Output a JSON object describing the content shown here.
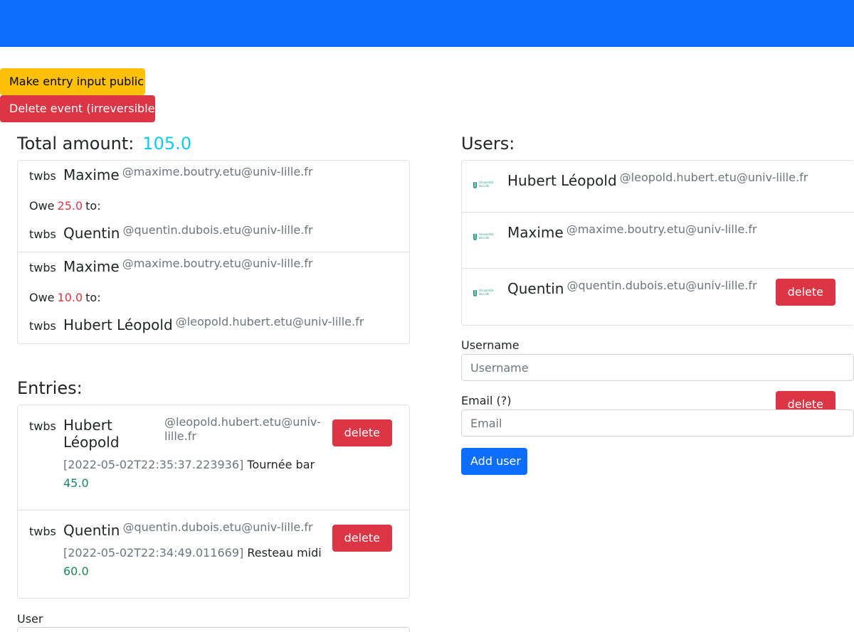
{
  "actions": {
    "make_public": "Make entry input public",
    "delete_event": "Delete event (irreversible)"
  },
  "total": {
    "label": "Total amount:",
    "value": "105.0"
  },
  "debts": [
    {
      "from": {
        "avatar": "twbs",
        "name": "Maxime",
        "email": "@maxime.boutry.etu@univ-lille.fr"
      },
      "owe_prefix": "Owe",
      "amount": "25.0",
      "owe_suffix": "to:",
      "to": {
        "avatar": "twbs",
        "name": "Quentin",
        "email": "@quentin.dubois.etu@univ-lille.fr"
      }
    },
    {
      "from": {
        "avatar": "twbs",
        "name": "Maxime",
        "email": "@maxime.boutry.etu@univ-lille.fr"
      },
      "owe_prefix": "Owe",
      "amount": "10.0",
      "owe_suffix": "to:",
      "to": {
        "avatar": "twbs",
        "name": "Hubert Léopold",
        "email": "@leopold.hubert.etu@univ-lille.fr"
      }
    }
  ],
  "entries_title": "Entries:",
  "entries": [
    {
      "avatar": "twbs",
      "name": "Hubert Léopold",
      "email": "@leopold.hubert.etu@univ-lille.fr",
      "date": "[2022-05-02T22:35:37.223936]",
      "label": "Tournée bar",
      "amount": "45.0",
      "delete_label": "delete"
    },
    {
      "avatar": "twbs",
      "name": "Quentin",
      "email": "@quentin.dubois.etu@univ-lille.fr",
      "date": "[2022-05-02T22:34:49.011669]",
      "label": "Resteau midi",
      "amount": "60.0",
      "delete_label": "delete"
    }
  ],
  "entry_form": {
    "user_label": "User"
  },
  "users_title": "Users:",
  "users": [
    {
      "logo_text": "Université de Lille",
      "name": "Hubert Léopold",
      "email": "@leopold.hubert.etu@univ-lille.fr"
    },
    {
      "logo_text": "Université de Lille",
      "name": "Maxime",
      "email": "@maxime.boutry.etu@univ-lille.fr",
      "delete_label": "delete"
    },
    {
      "logo_text": "Université de Lille",
      "name": "Quentin",
      "email": "@quentin.dubois.etu@univ-lille.fr",
      "delete_label": "delete"
    }
  ],
  "user_form": {
    "username_label": "Username",
    "username_placeholder": "Username",
    "email_label": "Email (?)",
    "email_placeholder": "Email",
    "submit_label": "Add user"
  },
  "colors": {
    "navbar": "#0d6efd",
    "warning": "#ffc107",
    "danger": "#dc3545",
    "info": "#0dcaf0",
    "success": "#198754"
  },
  "icons": {
    "user_logo": "univ-lille-logo-icon"
  }
}
